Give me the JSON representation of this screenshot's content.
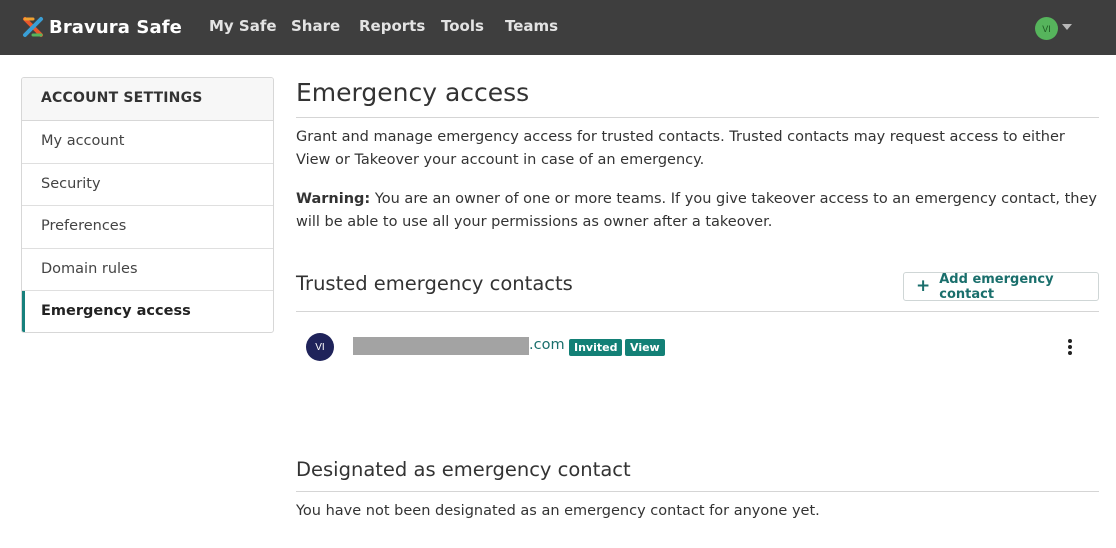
{
  "navbar": {
    "brand": "Bravura Safe",
    "links": [
      "My Safe",
      "Share",
      "Reports",
      "Tools",
      "Teams"
    ],
    "user_initials": "VI"
  },
  "sidebar": {
    "header": "ACCOUNT SETTINGS",
    "items": [
      {
        "label": "My account"
      },
      {
        "label": "Security"
      },
      {
        "label": "Preferences"
      },
      {
        "label": "Domain rules"
      },
      {
        "label": "Emergency access",
        "active": true
      }
    ]
  },
  "main": {
    "title": "Emergency access",
    "intro": "Grant and manage emergency access for trusted contacts. Trusted contacts may request access to either View or Takeover your account in case of an emergency.",
    "warning_label": "Warning:",
    "warning_text": " You are an owner of one or more teams. If you give takeover access to an emergency contact, they will be able to use all your permissions as owner after a takeover.",
    "trusted": {
      "title": "Trusted emergency contacts",
      "add_button": "Add emergency contact",
      "contacts": [
        {
          "initials": "VI",
          "email_suffix": ".com",
          "status": "Invited",
          "access": "View"
        }
      ]
    },
    "designated": {
      "title": "Designated as emergency contact",
      "empty_text": "You have not been designated as an emergency contact for anyone yet."
    }
  },
  "colors": {
    "navbar": "#3e3e3e",
    "accent": "#17807c",
    "badge": "#138076",
    "contact_avatar": "#1f235a",
    "user_avatar": "#56b45c"
  }
}
